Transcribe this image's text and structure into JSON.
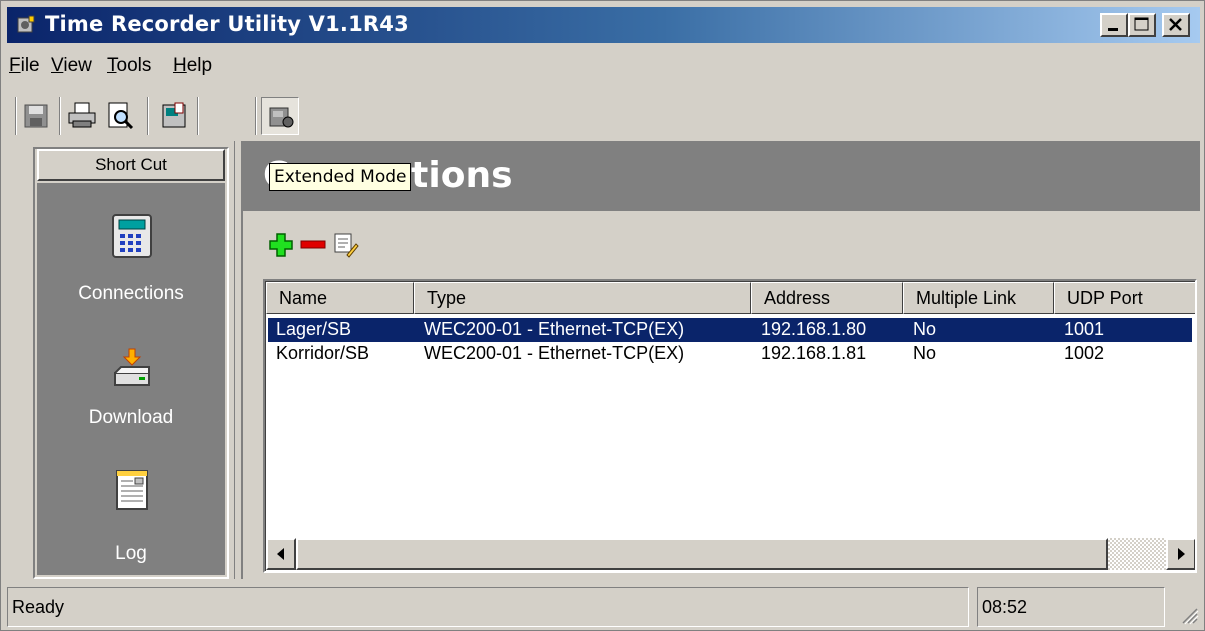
{
  "window": {
    "title": "Time Recorder Utility V1.1R43",
    "title_bar_colors": [
      "#0a246a",
      "#a6caf0"
    ]
  },
  "menu": {
    "items": [
      {
        "label": "File",
        "accel": "F",
        "rest": "ile"
      },
      {
        "label": "View",
        "accel": "V",
        "rest": "iew"
      },
      {
        "label": "Tools",
        "accel": "T",
        "rest": "ools"
      },
      {
        "label": "Help",
        "accel": "H",
        "rest": "elp"
      }
    ]
  },
  "toolbar": {
    "buttons": [
      {
        "icon": "save-icon"
      },
      {
        "icon": "print-icon"
      },
      {
        "icon": "print-preview-icon"
      },
      {
        "icon": "terminal-config-icon"
      },
      {
        "icon": "extended-mode-icon",
        "pressed": true
      }
    ]
  },
  "shortcut": {
    "header": "Short Cut",
    "items": [
      {
        "label": "Connections",
        "icon": "terminal-keypad-icon"
      },
      {
        "label": "Download",
        "icon": "download-drive-icon"
      },
      {
        "label": "Log",
        "icon": "log-document-icon"
      }
    ]
  },
  "main": {
    "title": "Connections",
    "tooltip": "Extended Mode",
    "actions": [
      {
        "icon": "add-icon"
      },
      {
        "icon": "remove-icon"
      },
      {
        "icon": "edit-icon"
      }
    ]
  },
  "list": {
    "columns": [
      "Name",
      "Type",
      "Address",
      "Multiple Link",
      "UDP Port"
    ],
    "rows": [
      {
        "name": "Lager/SB",
        "type": "WEC200-01 - Ethernet-TCP(EX)",
        "address": "192.168.1.80",
        "multiple_link": "No",
        "udp_port": "1001",
        "selected": true
      },
      {
        "name": "Korridor/SB",
        "type": "WEC200-01 - Ethernet-TCP(EX)",
        "address": "192.168.1.81",
        "multiple_link": "No",
        "udp_port": "1002",
        "selected": false
      }
    ]
  },
  "status": {
    "text": "Ready",
    "time": "08:52"
  },
  "colors": {
    "selection": "#0a246a",
    "sidebar_bg": "#808080",
    "face": "#d4d0c8",
    "tooltip_bg": "#ffffe1"
  }
}
